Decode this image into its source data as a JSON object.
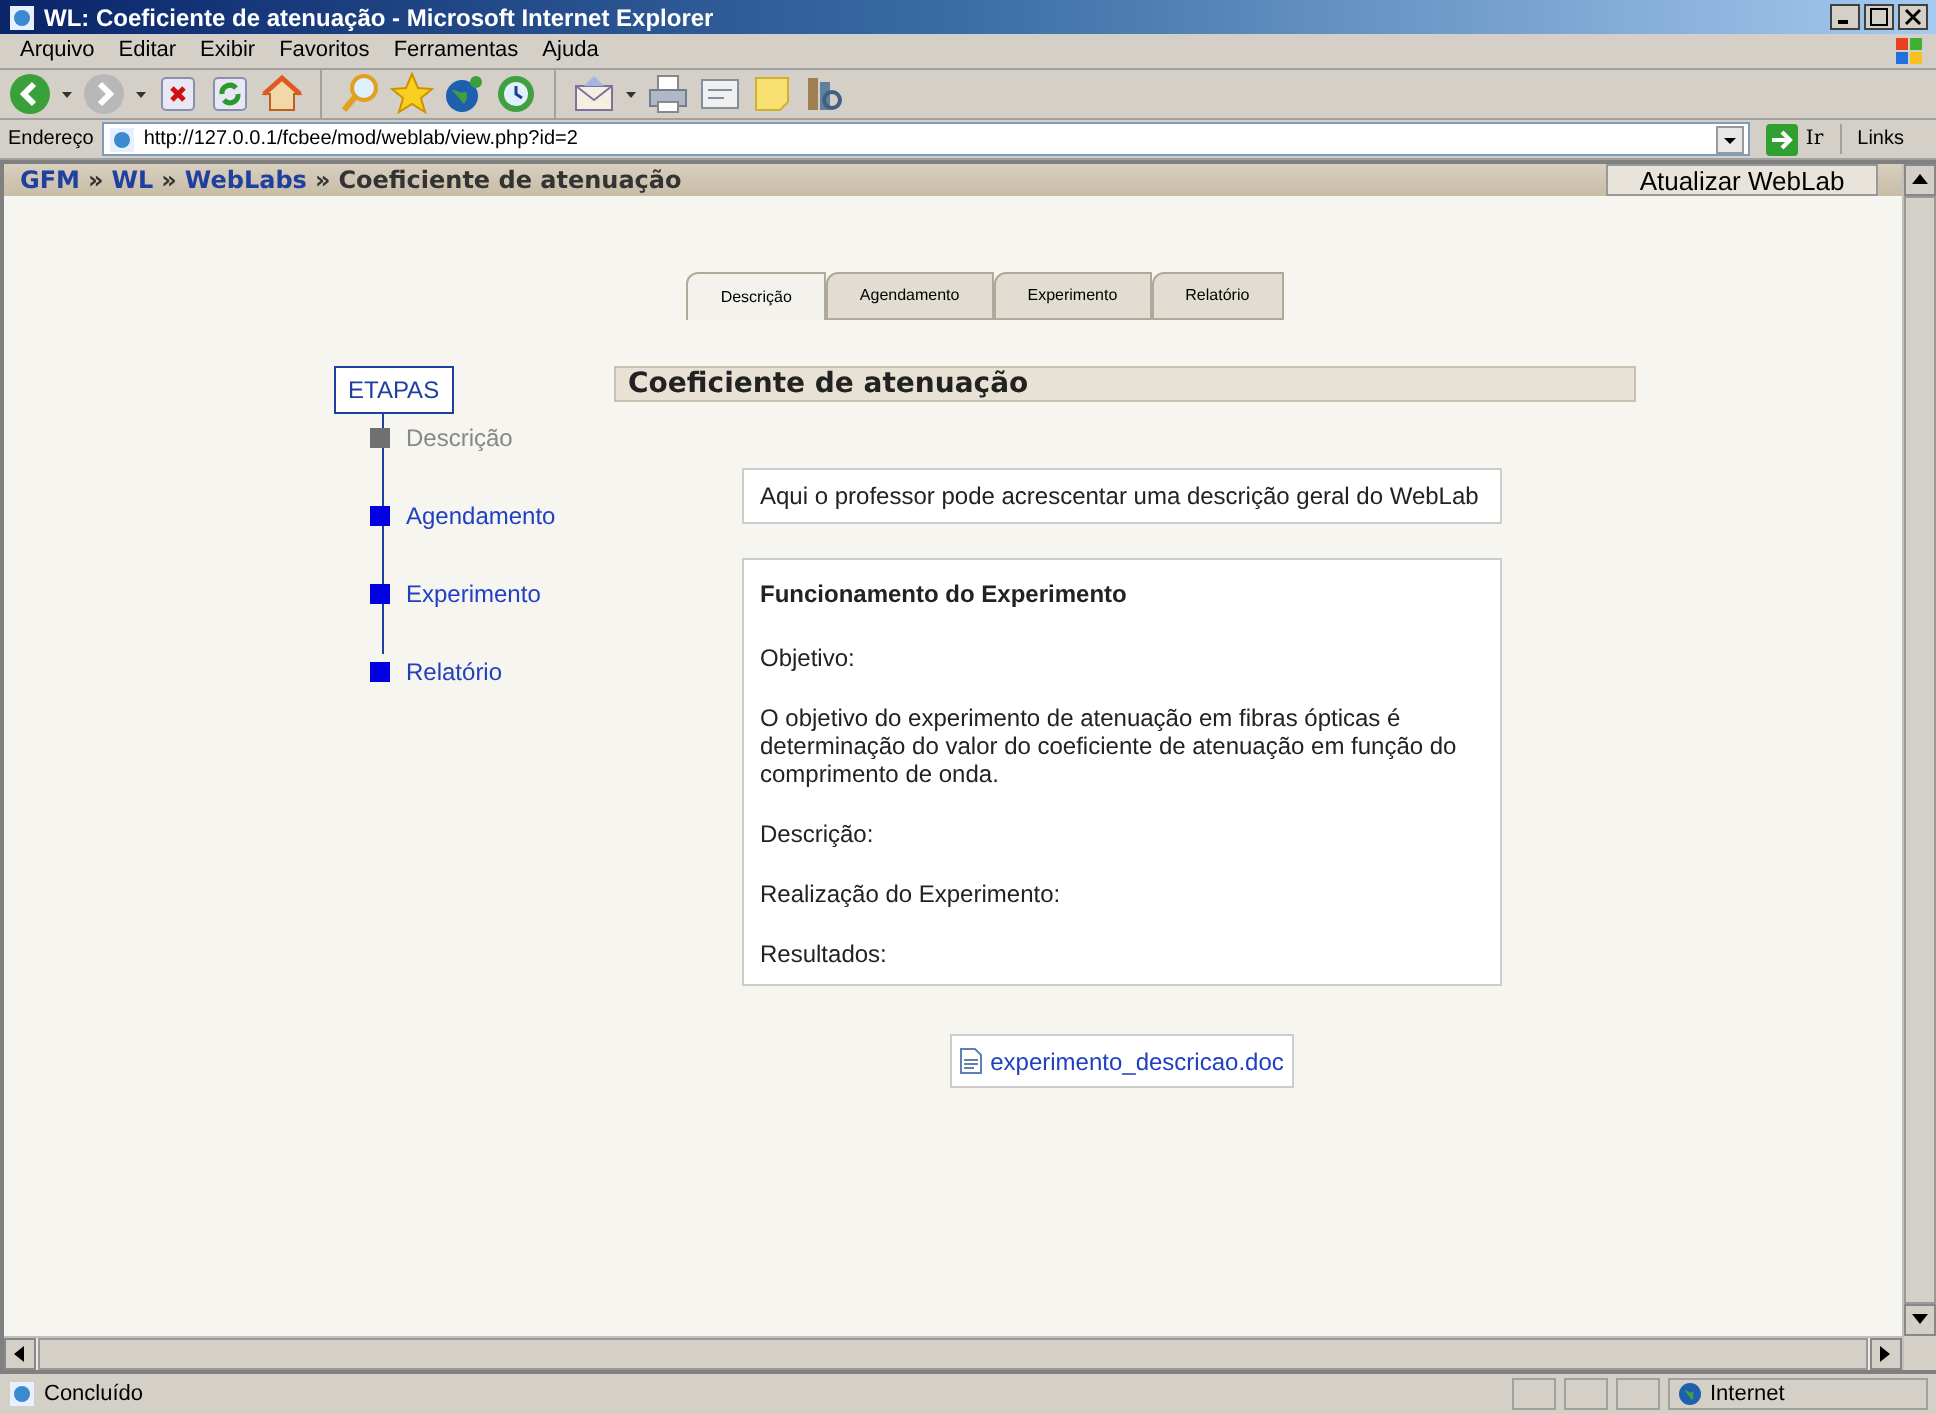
{
  "window": {
    "title": "WL: Coeficiente de atenuação - Microsoft Internet Explorer"
  },
  "menu": [
    "Arquivo",
    "Editar",
    "Exibir",
    "Favoritos",
    "Ferramentas",
    "Ajuda"
  ],
  "address": {
    "label": "Endereço",
    "url": "http://127.0.0.1/fcbee/mod/weblab/view.php?id=2",
    "go": "Ir",
    "links": "Links"
  },
  "breadcrumb": {
    "separator": "»",
    "items": [
      {
        "text": "GFM",
        "link": true
      },
      {
        "text": "WL",
        "link": true
      },
      {
        "text": "WebLabs",
        "link": true
      },
      {
        "text": "Coeficiente de atenuação",
        "link": false
      }
    ]
  },
  "update_button": "Atualizar WebLab",
  "tabs": [
    {
      "label": "Descrição",
      "selected": true
    },
    {
      "label": "Agendamento",
      "selected": false
    },
    {
      "label": "Experimento",
      "selected": false
    },
    {
      "label": "Relatório",
      "selected": false
    }
  ],
  "steps": {
    "title": "ETAPAS",
    "items": [
      {
        "label": "Descrição",
        "current": true
      },
      {
        "label": "Agendamento",
        "current": false
      },
      {
        "label": "Experimento",
        "current": false
      },
      {
        "label": "Relatório",
        "current": false
      }
    ]
  },
  "heading": "Coeficiente de atenuação",
  "intro": "Aqui o professor pode acrescentar uma descrição geral do WebLab",
  "section": {
    "title": "Funcionamento do Experimento",
    "paragraphs": [
      "Objetivo:",
      "O objetivo do experimento de atenuação em fibras ópticas é determinação do valor do coeficiente de atenuação em função do comprimento de onda.",
      "Descrição:",
      "Realização do Experimento:",
      "Resultados:"
    ]
  },
  "attachment": "experimento_descricao.doc",
  "status_bar": {
    "text": "Concluído",
    "zone": "Internet"
  }
}
